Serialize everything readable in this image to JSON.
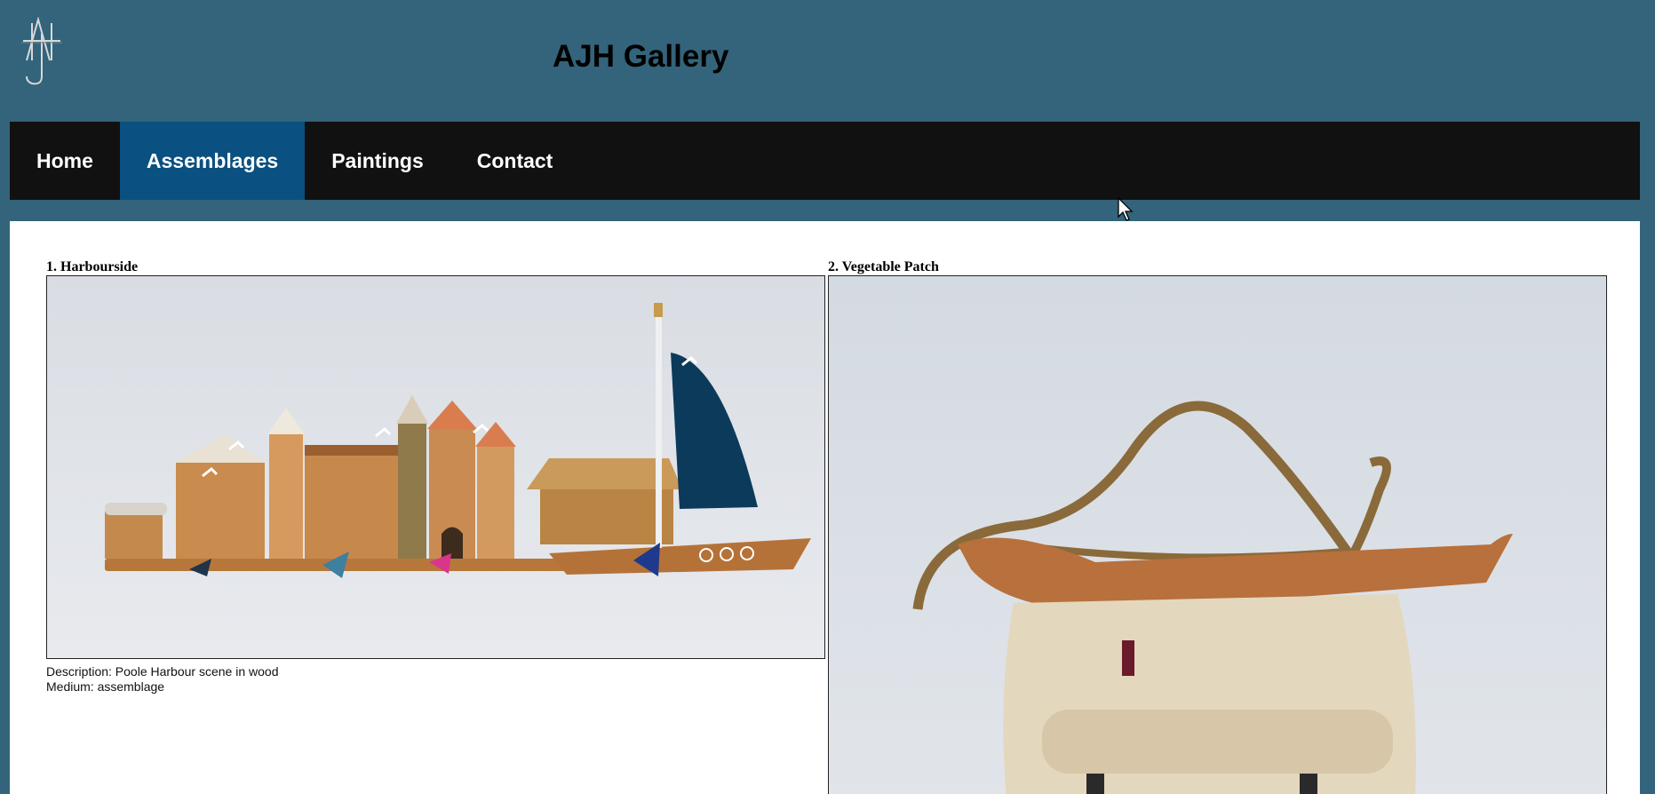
{
  "header": {
    "title": "AJH Gallery",
    "logo_letters": "AJH"
  },
  "nav": {
    "items": [
      {
        "label": "Home",
        "active": false
      },
      {
        "label": "Assemblages",
        "active": true
      },
      {
        "label": "Paintings",
        "active": false
      },
      {
        "label": "Contact",
        "active": false
      }
    ]
  },
  "gallery": {
    "items": [
      {
        "title": "1. Harbourside",
        "description": "Description: Poole Harbour scene in wood",
        "medium": "Medium: assemblage"
      },
      {
        "title": "2. Vegetable Patch"
      }
    ]
  },
  "colors": {
    "background": "#33647b",
    "nav": "#111111",
    "nav_active": "#0a5080"
  }
}
